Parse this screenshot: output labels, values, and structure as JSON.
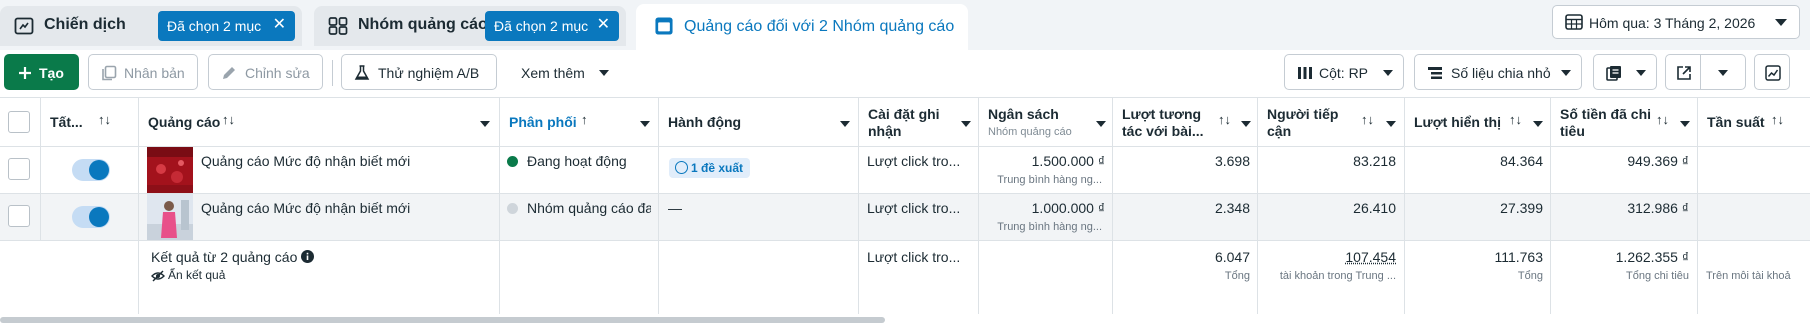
{
  "tabs": {
    "campaigns": {
      "title": "Chiến dịch",
      "chip": "Đã chọn 2 mục"
    },
    "adsets": {
      "title": "Nhóm quảng cáo",
      "chip": "Đã chọn 2 mục"
    },
    "ads": {
      "title": "Quảng cáo đối với 2 Nhóm quảng cáo"
    },
    "date_range": "Hôm qua: 3 Tháng 2, 2026",
    "close_glyph": "✕"
  },
  "toolbar": {
    "create": "Tạo",
    "duplicate": "Nhân bản",
    "edit": "Chỉnh sửa",
    "ab_test": "Thử nghiệm A/B",
    "more": "Xem thêm",
    "columns": "Cột: RP",
    "breakdown": "Số liệu chia nhỏ"
  },
  "table": {
    "headers": {
      "all": "Tất...",
      "ad": "Quảng cáo",
      "delivery": "Phân phối",
      "actions": "Hành động",
      "attribution": "Cài đặt ghi nhận",
      "budget": "Ngân sách",
      "budget_sub": "Nhóm quảng cáo",
      "engagement": "Lượt tương tác với bài...",
      "reach": "Người tiếp cận",
      "impressions": "Lượt hiển thị",
      "spend": "Số tiền đã chi tiêu",
      "frequency": "Tần suất"
    },
    "sort_glyph": "↑↓",
    "sort_asc_glyph": "↑",
    "rows": [
      {
        "name": "Quảng cáo Mức độ nhận biết mới",
        "delivery": "Đang hoạt động",
        "delivery_color": "#0a7a4a",
        "action": "1 đề xuất",
        "attribution": "Lượt click tro...",
        "budget": "1.500.000 ₫",
        "budget_sub": "Trung bình hàng ng...",
        "engagement": "3.698",
        "reach": "83.218",
        "impressions": "84.364",
        "spend": "949.369 ₫"
      },
      {
        "name": "Quảng cáo Mức độ nhận biết mới",
        "delivery": "Nhóm quảng cáo đa",
        "delivery_color": "#cfd5db",
        "action": "—",
        "attribution": "Lượt click tro...",
        "budget": "1.000.000 ₫",
        "budget_sub": "Trung bình hàng ng...",
        "engagement": "2.348",
        "reach": "26.410",
        "impressions": "27.399",
        "spend": "312.986 ₫"
      }
    ],
    "summary": {
      "title": "Kết quả từ 2 quảng cáo",
      "hide": "Ẩn kết quả",
      "attribution": "Lượt click tro...",
      "engagement": "6.047",
      "engagement_sub": "Tổng",
      "reach": "107.454",
      "reach_sub": "tài khoản trong Trung ...",
      "impressions": "111.763",
      "impressions_sub": "Tổng",
      "spend": "1.262.355 ₫",
      "spend_sub": "Tổng chi tiêu",
      "frequency_sub": "Trên mỗi tài khoả"
    }
  },
  "colors": {
    "accent": "#0a78be",
    "create_button": "#0a7a4a"
  }
}
